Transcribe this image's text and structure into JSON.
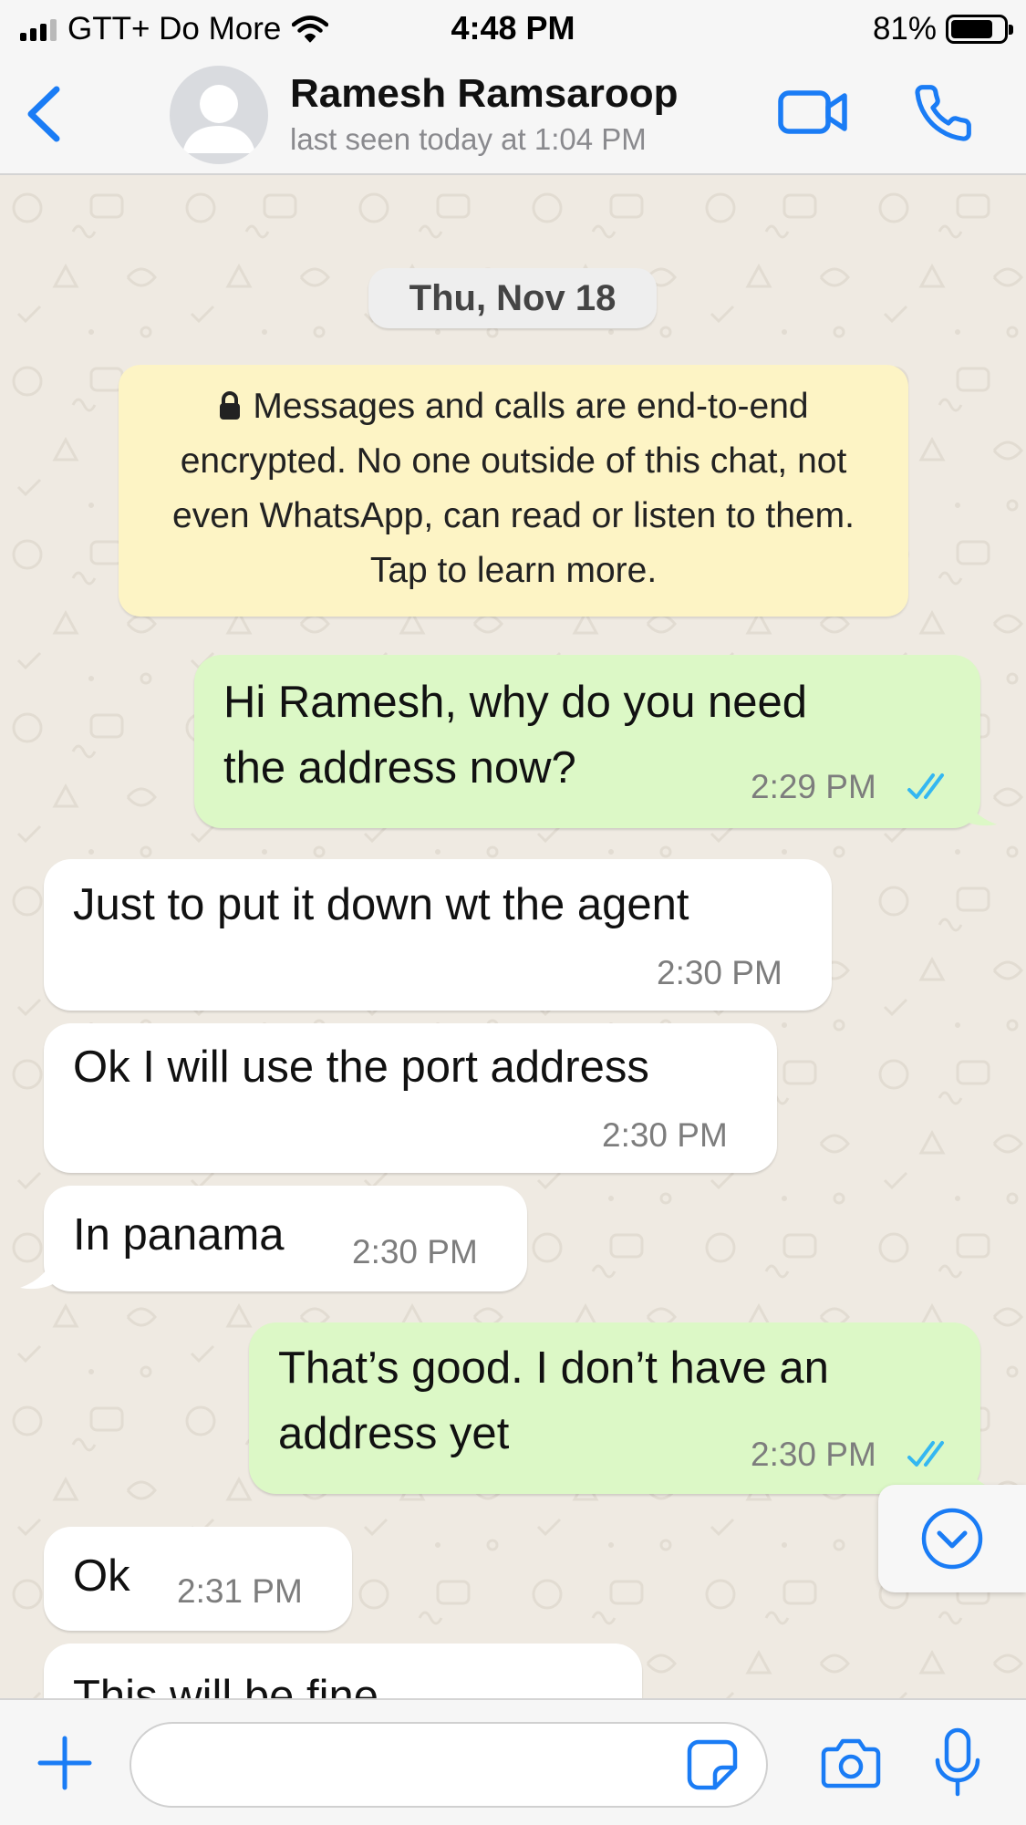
{
  "status_bar": {
    "carrier": "GTT+ Do More",
    "time": "4:48 PM",
    "battery_percent": "81%",
    "battery_level": 0.81,
    "icons": [
      "signal-icon",
      "wifi-icon",
      "battery-icon"
    ]
  },
  "header": {
    "contact_name": "Ramesh Ramsaroop",
    "last_seen": "last seen today at 1:04 PM",
    "icons": [
      "back-chevron-icon",
      "avatar-placeholder-icon",
      "video-camera-icon",
      "phone-icon"
    ]
  },
  "chat": {
    "date_chip": "Thu, Nov 18",
    "encryption_notice": "Messages and calls are end-to-end encrypted. No one outside of this chat, not even WhatsApp, can read or listen to them. Tap to learn more.",
    "messages": [
      {
        "direction": "outgoing",
        "lines": [
          "Hi Ramesh, why do you need",
          "the address now?"
        ],
        "time": "2:29 PM",
        "status": "read"
      },
      {
        "direction": "incoming",
        "lines": [
          "Just to put it down wt the agent"
        ],
        "time": "2:30 PM"
      },
      {
        "direction": "incoming",
        "lines": [
          "Ok I will use the port address"
        ],
        "time": "2:30 PM"
      },
      {
        "direction": "incoming",
        "lines": [
          "In panama"
        ],
        "time": "2:30 PM"
      },
      {
        "direction": "outgoing",
        "lines": [
          "That’s good. I don’t have an",
          "address yet"
        ],
        "time": "2:30 PM",
        "status": "read"
      },
      {
        "direction": "incoming",
        "lines": [
          "Ok"
        ],
        "time": "2:31 PM"
      },
      {
        "direction": "incoming",
        "lines": [
          "This will be fine"
        ],
        "time": ""
      }
    ]
  },
  "input_bar": {
    "placeholder": "",
    "value": "",
    "icons": [
      "plus-icon",
      "sticker-icon",
      "camera-icon",
      "microphone-icon"
    ]
  },
  "colors": {
    "accent": "#1a7cf5",
    "outgoing_bubble": "#dcf8c6",
    "incoming_bubble": "#ffffff",
    "read_ticks": "#34b7f1",
    "encryption_notice_bg": "#fdf4c5",
    "chat_background": "#efeae2"
  }
}
